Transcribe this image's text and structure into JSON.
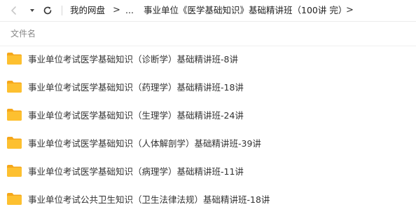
{
  "toolbar": {
    "back_icon": "chevron-down-icon",
    "refresh_icon": "refresh-icon"
  },
  "breadcrumb": {
    "root": "我的网盘",
    "sep1": ">",
    "ellipsis": "...",
    "current": "事业单位《医学基础知识》基础精讲班（100讲 完）",
    "sep2": ">"
  },
  "list_header": {
    "name_column": "文件名"
  },
  "files": [
    {
      "name": "事业单位考试医学基础知识（诊断学）基础精讲班-8讲",
      "icon": "folder-icon"
    },
    {
      "name": "事业单位考试医学基础知识（药理学）基础精讲班-18讲",
      "icon": "folder-icon"
    },
    {
      "name": "事业单位考试医学基础知识（生理学）基础精讲班-24讲",
      "icon": "folder-icon"
    },
    {
      "name": "事业单位考试医学基础知识（人体解剖学）基础精讲班-39讲",
      "icon": "folder-icon"
    },
    {
      "name": "事业单位考试医学基础知识（病理学）基础精讲班-11讲",
      "icon": "folder-icon"
    },
    {
      "name": "事业单位考试公共卫生知识（卫生法律法规）基础精讲班-18讲",
      "icon": "folder-icon"
    }
  ],
  "colors": {
    "folder": "#FDC030",
    "folder_dark": "#F5A71A",
    "text": "#333333",
    "muted": "#888888"
  }
}
